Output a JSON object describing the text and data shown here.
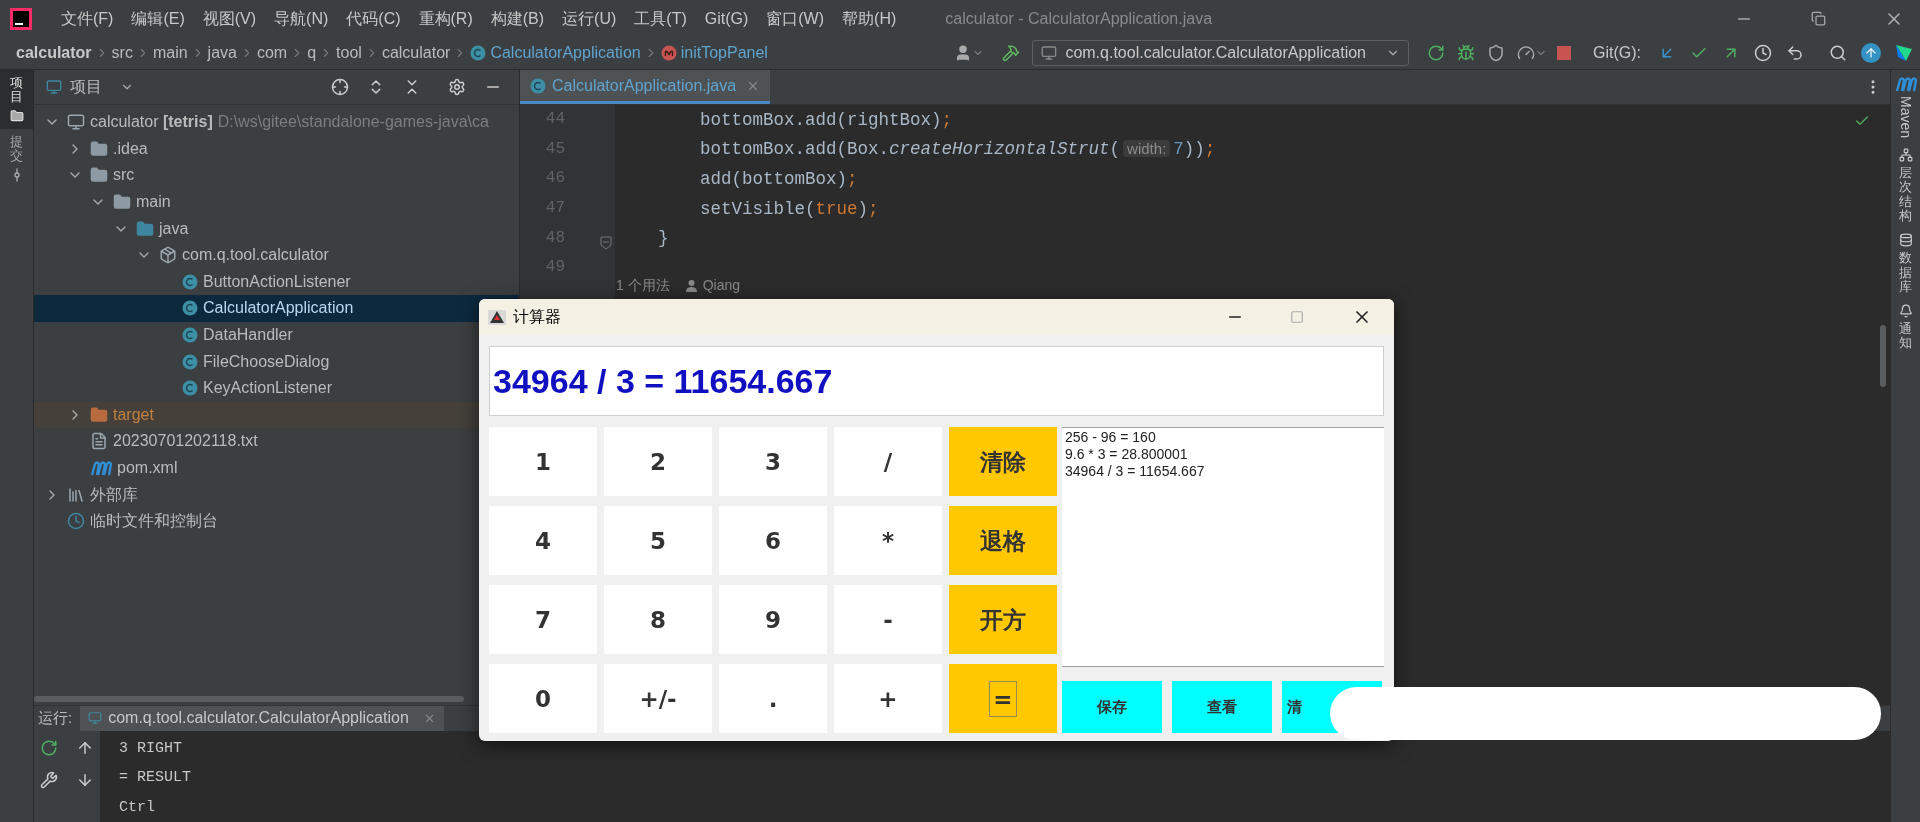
{
  "menu_bar": {
    "menus": [
      "文件(F)",
      "编辑(E)",
      "视图(V)",
      "导航(N)",
      "代码(C)",
      "重构(R)",
      "构建(B)",
      "运行(U)",
      "工具(T)",
      "Git(G)",
      "窗口(W)",
      "帮助(H)"
    ],
    "title": "calculator - CalculatorApplication.java"
  },
  "nav_bar": {
    "breadcrumbs": [
      {
        "label": "calculator",
        "kind": "project"
      },
      {
        "label": "src",
        "kind": "folder"
      },
      {
        "label": "main",
        "kind": "folder"
      },
      {
        "label": "java",
        "kind": "folder"
      },
      {
        "label": "com",
        "kind": "folder"
      },
      {
        "label": "q",
        "kind": "folder"
      },
      {
        "label": "tool",
        "kind": "folder"
      },
      {
        "label": "calculator",
        "kind": "folder"
      },
      {
        "label": "CalculatorApplication",
        "kind": "class"
      },
      {
        "label": "initTopPanel",
        "kind": "method"
      }
    ],
    "run_config": "com.q.tool.calculator.CalculatorApplication",
    "git_label": "Git(G):"
  },
  "left_strip": [
    {
      "label": "项目",
      "selected": true
    },
    {
      "label": "提交",
      "selected": false
    }
  ],
  "project_panel": {
    "title": "项目",
    "tree": [
      {
        "label": "calculator **[tetris]**",
        "path": "D:\\ws\\gitee\\standalone-games-java\\ca",
        "kind": "module",
        "expanded": true,
        "selected": false,
        "children": [
          {
            "label": ".idea",
            "kind": "folder",
            "expanded": false,
            "selected": false
          },
          {
            "label": "src",
            "kind": "folder",
            "expanded": true,
            "selected": false,
            "children": [
              {
                "label": "main",
                "kind": "folder",
                "expanded": true,
                "selected": false,
                "children": [
                  {
                    "label": "java",
                    "kind": "source",
                    "expanded": true,
                    "selected": false,
                    "children": [
                      {
                        "label": "com.q.tool.calculator",
                        "kind": "package",
                        "expanded": true,
                        "selected": false,
                        "children": [
                          {
                            "label": "ButtonActionListener",
                            "kind": "class",
                            "selected": false
                          },
                          {
                            "label": "CalculatorApplication",
                            "kind": "class",
                            "selected": true
                          },
                          {
                            "label": "DataHandler",
                            "kind": "class",
                            "selected": false
                          },
                          {
                            "label": "FileChooseDialog",
                            "kind": "class",
                            "selected": false
                          },
                          {
                            "label": "KeyActionListener",
                            "kind": "class",
                            "selected": false
                          }
                        ]
                      }
                    ]
                  }
                ]
              }
            ]
          },
          {
            "label": "target",
            "kind": "excluded",
            "expanded": false,
            "selected": false
          },
          {
            "label": "20230701202118.txt",
            "kind": "text",
            "selected": false
          },
          {
            "label": "pom.xml",
            "kind": "maven",
            "selected": false
          }
        ]
      },
      {
        "label": "外部库",
        "kind": "library",
        "expanded": false,
        "selected": false
      },
      {
        "label": "临时文件和控制台",
        "kind": "scratch",
        "selected": false
      }
    ]
  },
  "editor": {
    "tabs": [
      {
        "label": "CalculatorApplication.java",
        "selected": true
      }
    ],
    "lines": [
      {
        "number": "44",
        "tokens": [
          {
            "text": "        bottomBox.add(rightBox)",
            "kind": "plain"
          },
          {
            "text": ";",
            "kind": "punct"
          }
        ]
      },
      {
        "number": "45",
        "tokens": [
          {
            "text": "        bottomBox.add(Box.",
            "kind": "plain"
          },
          {
            "text": "createHorizontalStrut",
            "kind": "italic"
          },
          {
            "text": "(",
            "kind": "plain"
          },
          {
            "text": "width:",
            "kind": "hint"
          },
          {
            "text": "7",
            "kind": "number"
          },
          {
            "text": "))",
            "kind": "plain"
          },
          {
            "text": ";",
            "kind": "punct"
          }
        ]
      },
      {
        "number": "46",
        "tokens": [
          {
            "text": "        add(bottomBox)",
            "kind": "plain"
          },
          {
            "text": ";",
            "kind": "punct"
          }
        ]
      },
      {
        "number": "47",
        "tokens": [
          {
            "text": "        setVisible(",
            "kind": "plain"
          },
          {
            "text": "true",
            "kind": "keyword"
          },
          {
            "text": ")",
            "kind": "plain"
          },
          {
            "text": ";",
            "kind": "punct"
          }
        ]
      },
      {
        "number": "48",
        "tokens": [
          {
            "text": "    }",
            "kind": "plain"
          }
        ]
      },
      {
        "number": "49"
      }
    ],
    "usages": "1 个用法",
    "author": "Qiang"
  },
  "run_panel": {
    "label": "运行:",
    "tab": "com.q.tool.calculator.CalculatorApplication",
    "output": [
      "3 RIGHT",
      "= RESULT",
      "Ctrl"
    ]
  },
  "right_strip": [
    "Maven",
    "层次结构",
    "数据库",
    "通知"
  ],
  "calculator": {
    "title": "计算器",
    "display": "34964 / 3 = 11654.667",
    "keys": [
      {
        "label": "1",
        "kind": "digit",
        "focused": false
      },
      {
        "label": "2",
        "kind": "digit",
        "focused": false
      },
      {
        "label": "3",
        "kind": "digit",
        "focused": false
      },
      {
        "label": "/",
        "kind": "digit",
        "focused": false
      },
      {
        "label": "清除",
        "kind": "function",
        "focused": false
      },
      {
        "label": "4",
        "kind": "digit",
        "focused": false
      },
      {
        "label": "5",
        "kind": "digit",
        "focused": false
      },
      {
        "label": "6",
        "kind": "digit",
        "focused": false
      },
      {
        "label": "*",
        "kind": "digit",
        "focused": false
      },
      {
        "label": "退格",
        "kind": "function",
        "focused": false
      },
      {
        "label": "7",
        "kind": "digit",
        "focused": false
      },
      {
        "label": "8",
        "kind": "digit",
        "focused": false
      },
      {
        "label": "9",
        "kind": "digit",
        "focused": false
      },
      {
        "label": "-",
        "kind": "digit",
        "focused": false
      },
      {
        "label": "开方",
        "kind": "function",
        "focused": false
      },
      {
        "label": "0",
        "kind": "digit",
        "focused": false
      },
      {
        "label": "+/-",
        "kind": "digit",
        "focused": false
      },
      {
        "label": ".",
        "kind": "digit",
        "focused": false
      },
      {
        "label": "+",
        "kind": "digit",
        "focused": false
      },
      {
        "label": "=",
        "kind": "function",
        "focused": true
      }
    ],
    "history": [
      "256 - 96 = 160",
      "9.6 * 3 = 28.800001",
      "34964 / 3 = 11654.667"
    ],
    "actions": [
      "保存",
      "查看",
      "清"
    ]
  }
}
